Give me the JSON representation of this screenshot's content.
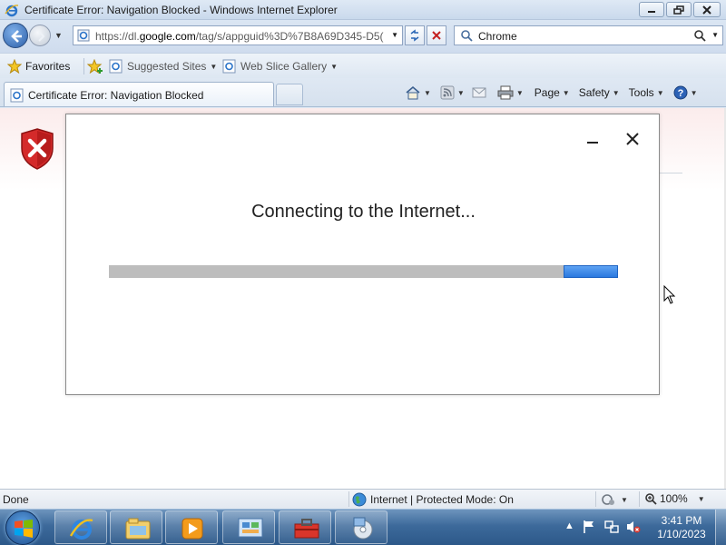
{
  "window": {
    "title": "Certificate Error: Navigation Blocked - Windows Internet Explorer"
  },
  "address_bar": {
    "url_prefix": "https://dl.",
    "url_domain": "google.com",
    "url_path": "/tag/s/appguid%3D%7B8A69D345-D5("
  },
  "search": {
    "value": "Chrome"
  },
  "favorites_bar": {
    "favorites_label": "Favorites",
    "suggested_sites_label": "Suggested Sites",
    "web_slice_gallery_label": "Web Slice Gallery"
  },
  "tab": {
    "label": "Certificate Error: Navigation Blocked"
  },
  "command_bar": {
    "page_label": "Page",
    "safety_label": "Safety",
    "tools_label": "Tools"
  },
  "dialog": {
    "message": "Connecting to the Internet...",
    "progress": {
      "fill_start": 0.893,
      "fill_end": 1.0
    }
  },
  "status_bar": {
    "status_text": "Done",
    "zone_text": "Internet | Protected Mode: On",
    "zoom_text": "100%"
  },
  "taskbar": {
    "clock_time": "3:41 PM",
    "clock_date": "1/10/2023"
  },
  "colors": {
    "progress_fill": "#2a78df",
    "progress_track": "#bdbdbd",
    "shield_red": "#d42a2a",
    "taskbar": "#3d6a9b"
  }
}
